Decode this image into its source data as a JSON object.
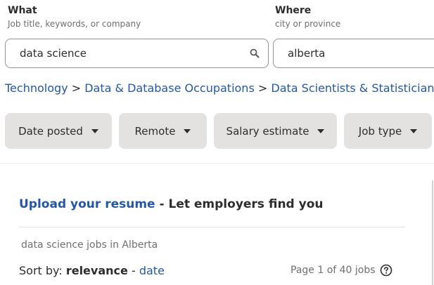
{
  "search": {
    "what_label": "What",
    "what_sub": "Job title, keywords, or company",
    "what_value": "data science",
    "where_label": "Where",
    "where_sub": "city or province",
    "where_value": "alberta"
  },
  "breadcrumb": {
    "items": [
      "Technology",
      "Data & Database Occupations",
      "Data Scientists & Statisticians"
    ],
    "separator": ">"
  },
  "filters": [
    "Date posted",
    "Remote",
    "Salary estimate",
    "Job type"
  ],
  "promo": {
    "link": "Upload your resume",
    "text": " - Let employers find you"
  },
  "results": {
    "count_text": "data science jobs in Alberta",
    "sort_label": "Sort by:",
    "sort_active": "relevance",
    "sort_dash": "-",
    "sort_alt": "date",
    "page_text": "Page 1 of 40 jobs"
  },
  "colors": {
    "link": "#2557a7",
    "chip": "#e4e2e0"
  }
}
